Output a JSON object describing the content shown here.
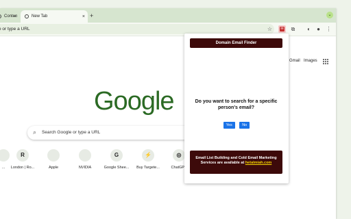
{
  "tabs": [
    {
      "label": "Conten",
      "close": "×"
    },
    {
      "label": "New Tab",
      "close": "×"
    }
  ],
  "new_tab_button": "+",
  "window_button": "⌄",
  "omnibox": {
    "text": "e or type a URL"
  },
  "top_links": {
    "gmail": "Gmail",
    "images": "Images"
  },
  "google_logo": "Google",
  "search": {
    "placeholder": "Search Google or type a URL"
  },
  "shortcuts": [
    {
      "letter": "",
      "label": "..."
    },
    {
      "letter": "R",
      "label": "London | Ro..."
    },
    {
      "letter": "",
      "label": "Apple"
    },
    {
      "letter": "",
      "label": "NVIDIA"
    },
    {
      "letter": "G",
      "label": "Google Shee..."
    },
    {
      "letter": "⚡",
      "label": "Buy Targete..."
    },
    {
      "letter": "◎",
      "label": "ChatGPT"
    }
  ],
  "popup": {
    "title": "Domain Email Finder",
    "question": "Do you want to search for a specific person's email?",
    "yes": "Yes",
    "no": "No",
    "footer_text": "Email List Building and Cold Email Marketing Services are available at",
    "footer_link": "hetalmiah.com",
    "header_color": "#3d0a0a",
    "link_color": "#f5d400"
  }
}
